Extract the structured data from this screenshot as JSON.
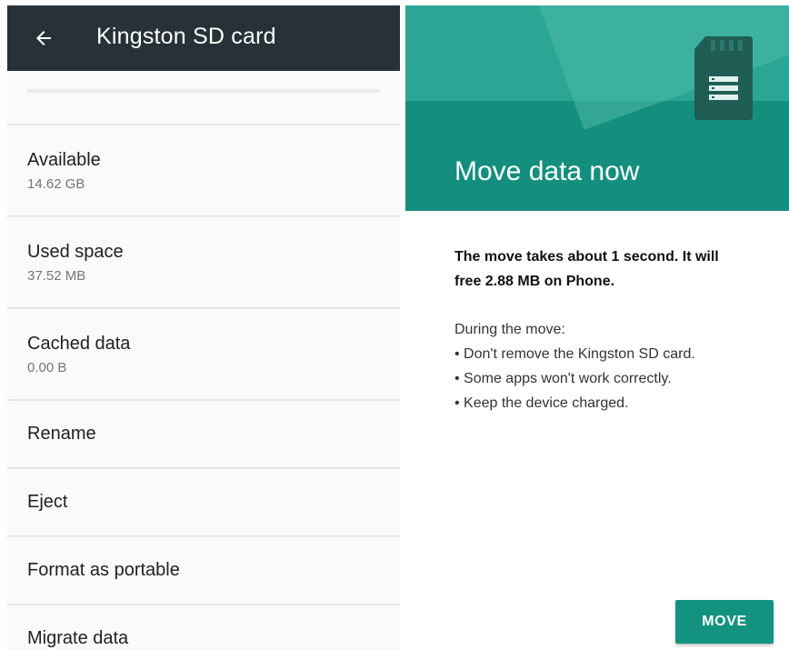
{
  "left_panel": {
    "appbar": {
      "title": "Kingston SD card",
      "back_icon": "arrow-left-icon"
    },
    "items": [
      {
        "title": "Available",
        "subtitle": "14.62 GB"
      },
      {
        "title": "Used space",
        "subtitle": "37.52 MB"
      },
      {
        "title": "Cached data",
        "subtitle": "0.00 B"
      },
      {
        "title": "Rename"
      },
      {
        "title": "Eject"
      },
      {
        "title": "Format as portable"
      },
      {
        "title": "Migrate data"
      }
    ]
  },
  "right_panel": {
    "hero": {
      "title": "Move data now",
      "icon": "sd-card-icon"
    },
    "summary": "The move takes about 1 second. It will free 2.88 MB on Phone.",
    "during_label": "During the move:",
    "bullets": [
      "• Don't remove the Kingston SD card.",
      "• Some apps won't work correctly.",
      "• Keep the device charged."
    ],
    "move_button": "MOVE"
  },
  "colors": {
    "appbar": "#263238",
    "teal": "#148f7e",
    "teal_light": "#2ba695",
    "button": "#13937f"
  }
}
